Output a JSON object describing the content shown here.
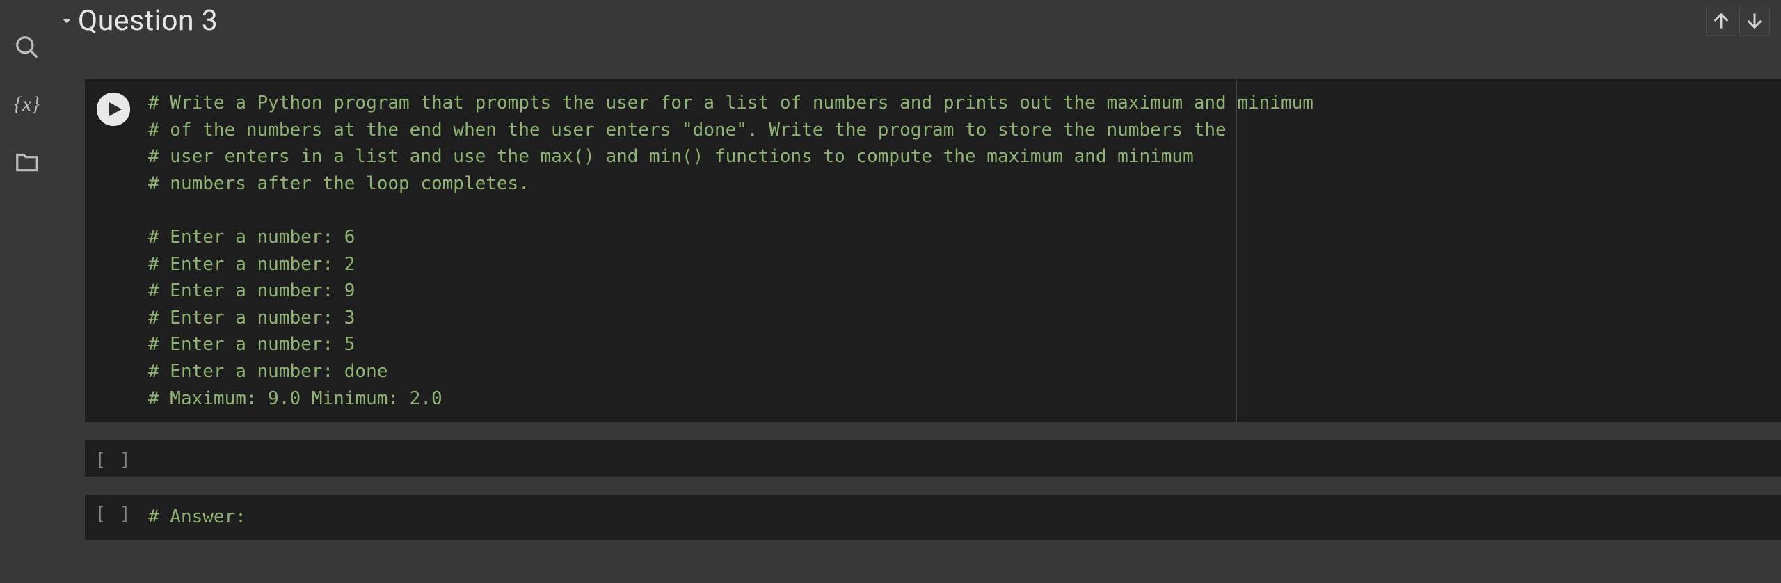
{
  "section": {
    "title": "Question 3"
  },
  "sidebar": {
    "icons": [
      "search-icon",
      "variables-icon",
      "files-icon"
    ],
    "variables_glyph": "{x}"
  },
  "header_actions": {
    "up": "↑",
    "down": "↓"
  },
  "cells": [
    {
      "kind": "code-run",
      "lines": [
        "# Write a Python program that prompts the user for a list of numbers and prints out the maximum and minimum",
        "# of the numbers at the end when the user enters \"done\". Write the program to store the numbers the",
        "# user enters in a list and use the max() and min() functions to compute the maximum and minimum",
        "# numbers after the loop completes.",
        "",
        "# Enter a number: 6",
        "# Enter a number: 2",
        "# Enter a number: 9",
        "# Enter a number: 3",
        "# Enter a number: 5",
        "# Enter a number: done",
        "# Maximum: 9.0 Minimum: 2.0"
      ]
    },
    {
      "kind": "code-empty",
      "prompt": "[ ]",
      "lines": [
        ""
      ]
    },
    {
      "kind": "code-answer",
      "prompt": "[ ]",
      "lines": [
        "# Answer:"
      ]
    }
  ]
}
